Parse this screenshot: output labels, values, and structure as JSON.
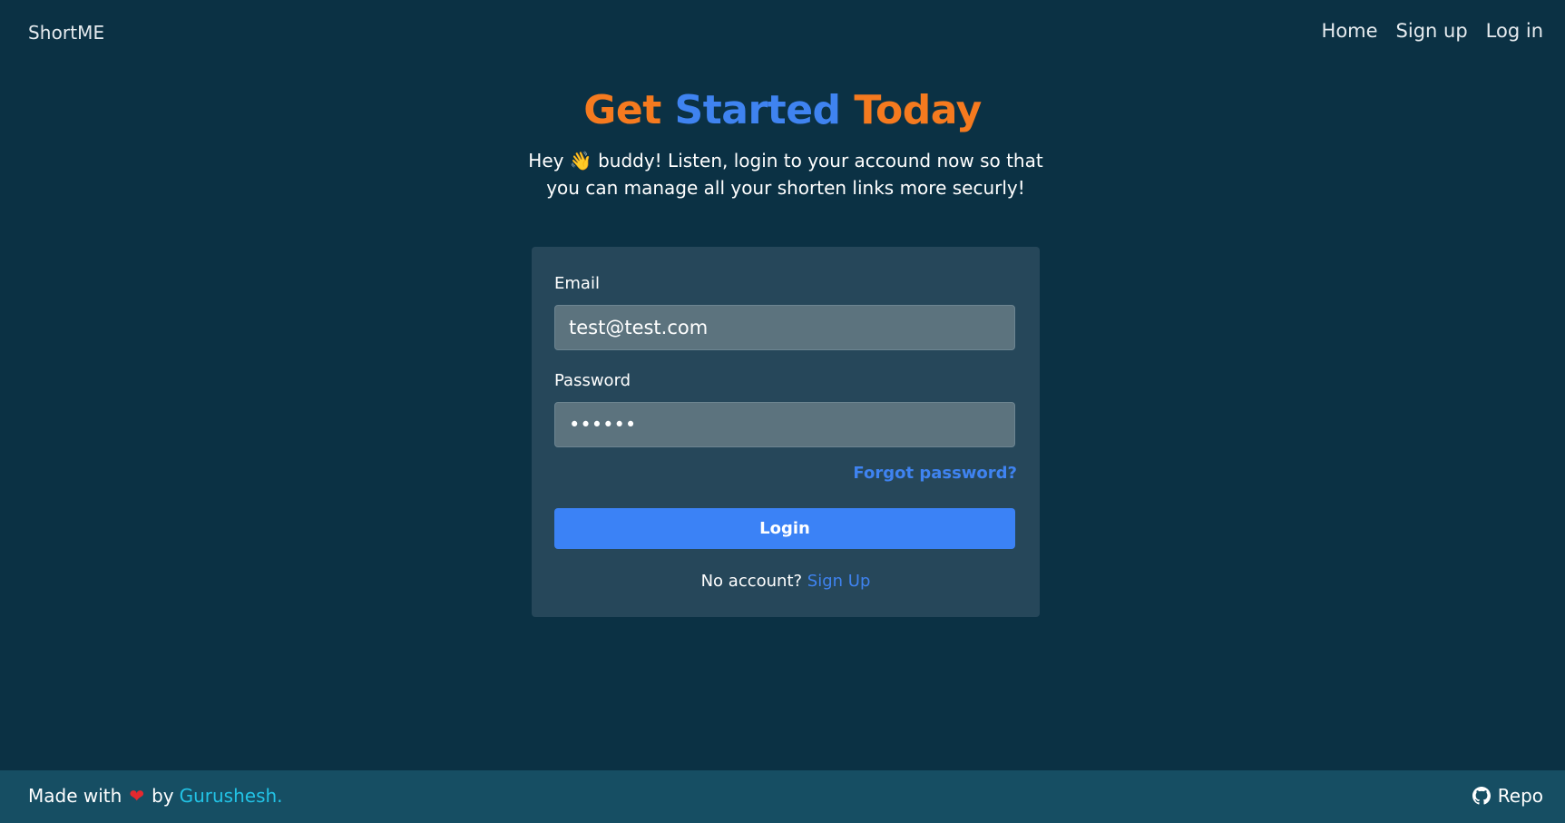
{
  "navbar": {
    "brand": "ShortME",
    "links": [
      "Home",
      "Sign up",
      "Log in"
    ]
  },
  "hero": {
    "title_part1": "Get ",
    "title_part2": "Started",
    "title_part3": " Today",
    "subtitle": "Hey 👋 buddy! Listen, login to your accound now so that you can manage all your shorten links more securly!"
  },
  "form": {
    "email_label": "Email",
    "email_value": "test@test.com",
    "password_label": "Password",
    "password_value": "••••••",
    "forgot_label": "Forgot password?",
    "login_label": "Login",
    "no_account_text": "No account?",
    "signup_label": "Sign Up"
  },
  "footer": {
    "made_with": "Made with",
    "heart": "❤",
    "by": "by",
    "author": "Gurushesh.",
    "repo_label": "Repo"
  },
  "colors": {
    "background": "#0b3144",
    "card": "#26475a",
    "input": "#5c737e",
    "accent_blue": "#3b82f6",
    "accent_orange": "#f57a1f",
    "footer": "#164e63",
    "author_link": "#22c3e6"
  },
  "icons": {
    "heart": "heart-icon",
    "repo": "github-icon"
  }
}
